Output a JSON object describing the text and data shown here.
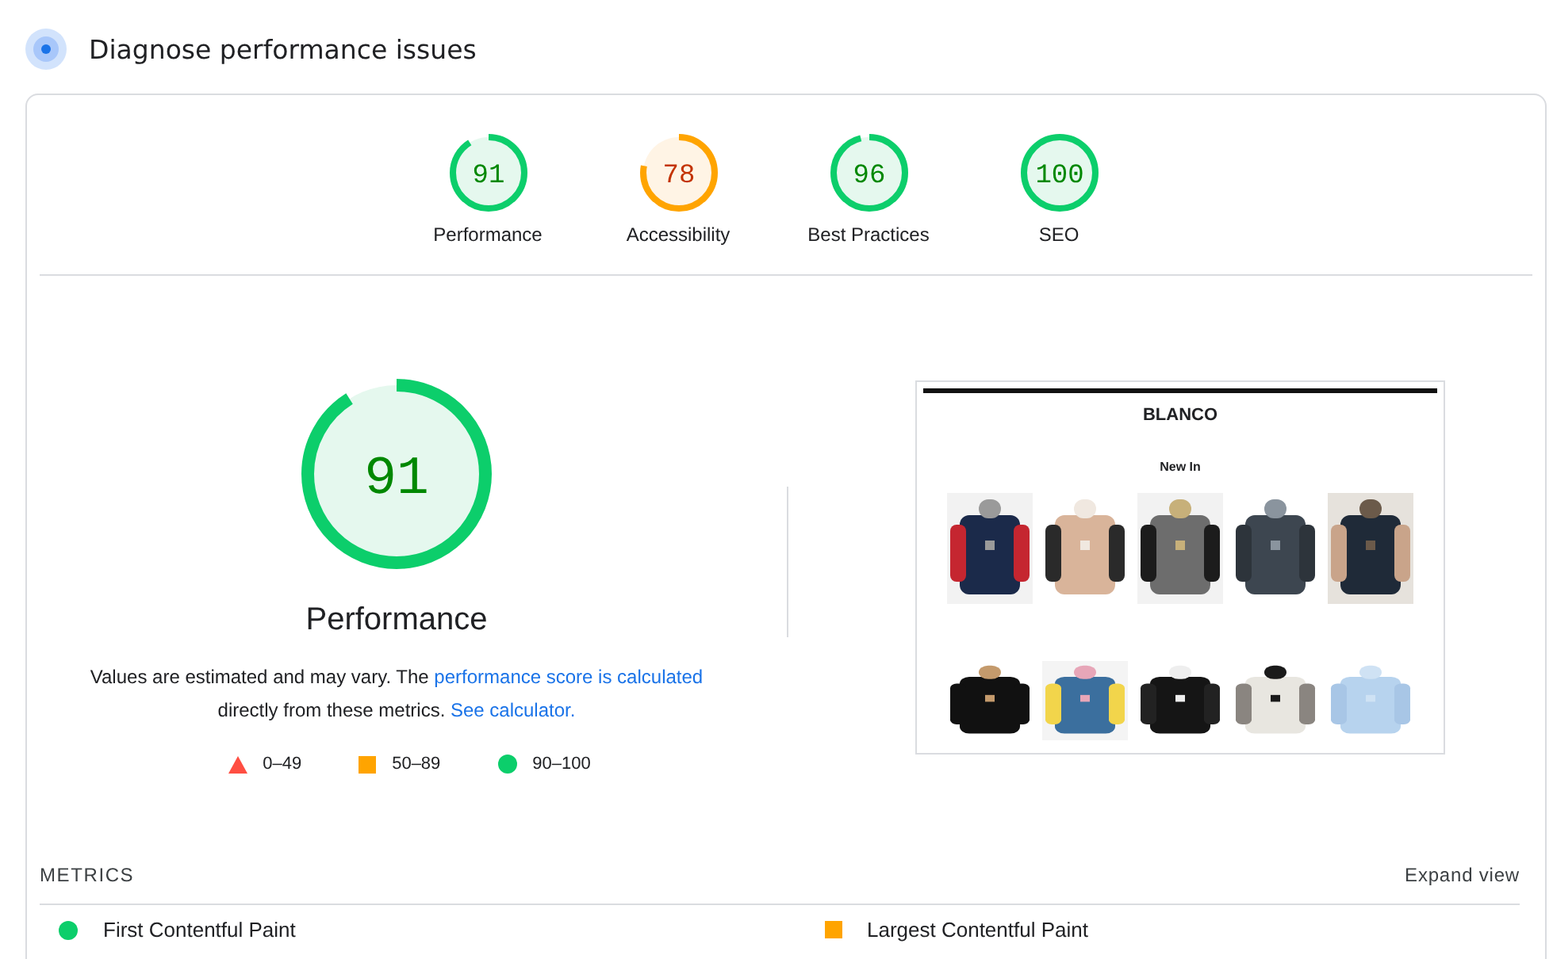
{
  "section": {
    "title": "Diagnose performance issues"
  },
  "categories": [
    {
      "score": "91",
      "label": "Performance",
      "level": 0.91
    },
    {
      "score": "78",
      "label": "Accessibility",
      "level": 0.78
    },
    {
      "score": "96",
      "label": "Best Practices",
      "level": 0.96
    },
    {
      "score": "100",
      "label": "SEO",
      "level": 1
    }
  ],
  "main_gauge": {
    "score": "91",
    "label": "Performance",
    "level": 0.91
  },
  "description": {
    "before": "Values are estimated and may vary. The",
    "link1": "performance score is calculated",
    "middle": "directly from these metrics.",
    "link2": "See calculator."
  },
  "legend": [
    {
      "kind": "triangle",
      "range": "0–49"
    },
    {
      "kind": "square",
      "range": "50–89"
    },
    {
      "kind": "circle",
      "range": "90–100"
    }
  ],
  "screenshot": {
    "site_title": "BLANCO",
    "heading": "New In"
  },
  "metrics_header": {
    "title": "METRICS",
    "toggle": "Expand view"
  },
  "metrics": [
    {
      "name": "First Contentful Paint",
      "kind": "circle"
    },
    {
      "name": "Largest Contentful Paint",
      "kind": "square"
    }
  ]
}
